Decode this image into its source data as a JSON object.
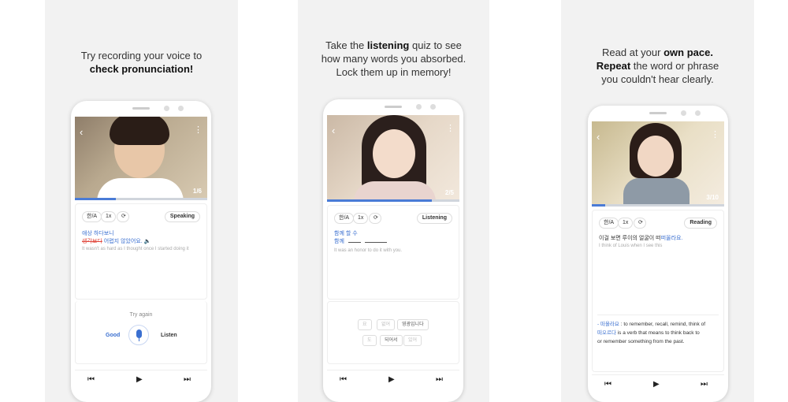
{
  "panels": [
    {
      "caption_line1": "Try recording your voice to",
      "caption_line2_bold": "check pronunciation!",
      "counter": "1/6",
      "progress": 0.31,
      "chips": [
        "한/A",
        "1x"
      ],
      "mode": "Speaking",
      "kor_line1": "애상 하다보니",
      "kor_line2_strike": "생각보다",
      "kor_line2_rest": "어렵지 않았어요.",
      "eng_line": "It wasn't as hard as I thought once I started doing it",
      "try_again": "Try again",
      "good": "Good",
      "listen": "Listen"
    },
    {
      "caption_line1_pre": "Take the",
      "caption_line1_bold": "listening",
      "caption_line1_post": "quiz to see",
      "caption_line2": "how many words you absorbed.",
      "caption_line3": "Lock them up in memory!",
      "counter": "2/5",
      "progress": 0.79,
      "chips": [
        "한/A",
        "1x"
      ],
      "mode": "Listening",
      "kor_line1": "함께 할 수",
      "kor_line2": "함께",
      "eng_line": "It was an honor to do it with you.",
      "words": [
        "요",
        "없어",
        "영광입니다",
        "도",
        "되어서",
        "있어"
      ]
    },
    {
      "caption_line1_pre": "Read at your",
      "caption_line1_bold": "own pace.",
      "caption_line2_bold": "Repeat",
      "caption_line2_post": "the word or phrase",
      "caption_line3": "you couldn't hear clearly.",
      "counter": "3/10",
      "progress": 0.1,
      "chips": [
        "한/A",
        "1x"
      ],
      "mode": "Reading",
      "kor_line1_pre": "이걸 보면 루이의 얼굴이 떠",
      "kor_line1_hl": "떠올라요.",
      "eng_line": "I think of Louis when I see this",
      "def1_hl": "- 떠올라요",
      "def1_rest": ": to remember, recall, remind, think of",
      "def2_hl": "떠오르다",
      "def2_rest": "is a verb that means to think back to",
      "def3": "or remember something from the past."
    }
  ],
  "icons": {
    "prev": "skip-previous-icon",
    "play": "play-icon",
    "next": "skip-next-icon",
    "mic": "microphone-icon"
  },
  "colors": {
    "accent": "#4a7bd6",
    "strike": "#e0453a"
  }
}
